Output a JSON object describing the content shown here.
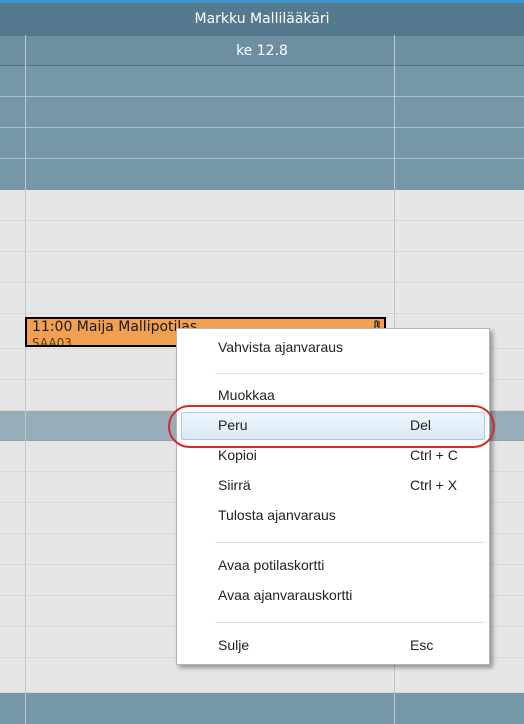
{
  "header": {
    "doctor": "Markku Mallilääkäri",
    "date": "ke 12.8"
  },
  "appointment": {
    "title": "11:00 Maija Mallipotilas",
    "code": "SAA03",
    "color": "#f0a050"
  },
  "menu": {
    "items": [
      {
        "label": "Vahvista ajanvaraus",
        "shortcut": ""
      },
      {
        "label": "Muokkaa",
        "shortcut": ""
      },
      {
        "label": "Peru",
        "shortcut": "Del"
      },
      {
        "label": "Kopioi",
        "shortcut": "Ctrl + C"
      },
      {
        "label": "Siirrä",
        "shortcut": "Ctrl + X"
      },
      {
        "label": "Tulosta ajanvaraus",
        "shortcut": ""
      },
      {
        "label": "Avaa potilaskortti",
        "shortcut": ""
      },
      {
        "label": "Avaa ajanvarauskortti",
        "shortcut": ""
      },
      {
        "label": "Sulje",
        "shortcut": "Esc"
      }
    ],
    "highlighted": "Peru"
  },
  "colors": {
    "header": "#567a8d",
    "row_blue": "#7597a8",
    "highlight_circle": "#d42a2a"
  }
}
